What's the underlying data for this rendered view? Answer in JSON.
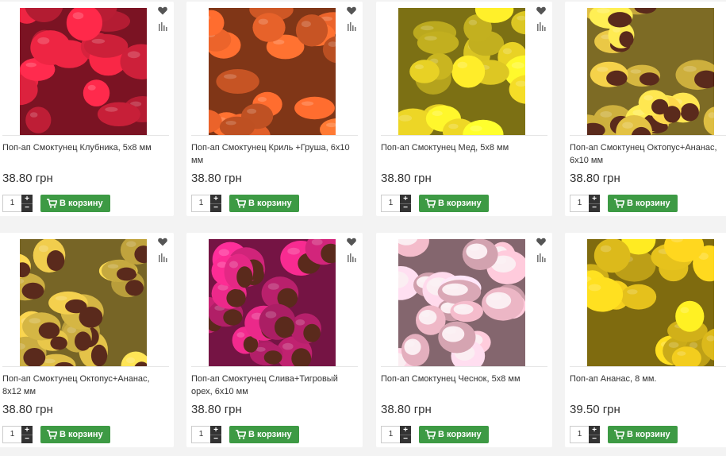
{
  "currency_suffix": "грн",
  "cart_button_label": "В корзину",
  "stepper": {
    "plus": "+",
    "minus": "−"
  },
  "products": [
    {
      "name": "Поп-ап Смоктунец Клубника, 5x8 мм",
      "price": "38.80 грн",
      "qty": "1",
      "image": "strawberry-red-baits",
      "color": "#e0233f",
      "has_wishlist": true
    },
    {
      "name": "Поп-ап Смоктунец Криль +Груша, 6x10 мм",
      "price": "38.80 грн",
      "qty": "1",
      "image": "orange-krill-baits",
      "color": "#e8622a",
      "has_wishlist": true
    },
    {
      "name": "Поп-ап Смоктунец Мед, 5x8 мм",
      "price": "38.80 грн",
      "qty": "1",
      "image": "yellow-honey-baits",
      "color": "#e2cc24",
      "has_wishlist": true
    },
    {
      "name": "Поп-ап Смоктунец Октопус+Ананас, 6x10 мм",
      "price": "38.80 грн",
      "qty": "1",
      "image": "yellow-brown-octopus-baits",
      "color": "#e3c244",
      "has_wishlist": false
    },
    {
      "name": "Поп-ап Смоктунец Октопус+Ананас, 8x12 мм",
      "price": "38.80 грн",
      "qty": "1",
      "image": "yellow-brown-octopus-baits",
      "color": "#d8b845",
      "has_wishlist": true
    },
    {
      "name": "Поп-ап Смоктунец Слива+Тигровый орех, 6x10 мм",
      "price": "38.80 грн",
      "qty": "1",
      "image": "pink-brown-plum-baits",
      "color": "#d4257c",
      "has_wishlist": true
    },
    {
      "name": "Поп-ап Смоктунец Чеснок, 5x8 мм",
      "price": "38.80 грн",
      "qty": "1",
      "image": "pink-white-garlic-baits",
      "color": "#f0b9c8",
      "has_wishlist": true
    },
    {
      "name": "Поп-ап Ананас, 8 мм.",
      "price": "39.50 грн",
      "qty": "1",
      "image": "yellow-pineapple-baits",
      "color": "#e6c21c",
      "has_wishlist": false
    }
  ]
}
